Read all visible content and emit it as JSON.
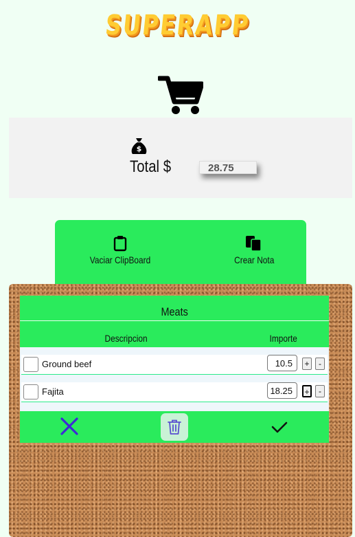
{
  "header": {
    "logo_text": "SUPERAPP",
    "cart_icon": "shopping-cart-icon"
  },
  "total": {
    "icon": "money-bag-icon",
    "label": "Total $",
    "value": "28.75"
  },
  "actions": {
    "clear_clipboard": "Vaciar ClipBoard",
    "create_note": "Crear Nota"
  },
  "note": {
    "title": "Meats",
    "columns": {
      "description": "Descripcion",
      "amount": "Importe"
    },
    "items": [
      {
        "description": "Ground beef",
        "amount": "10.5"
      },
      {
        "description": "Fajita",
        "amount": "18.25"
      }
    ],
    "plus_label": "+",
    "minus_label": "-"
  },
  "colors": {
    "accent_green": "#2aeb5c",
    "cork": "#c88b56",
    "close_blue": "#3d2bd6"
  }
}
